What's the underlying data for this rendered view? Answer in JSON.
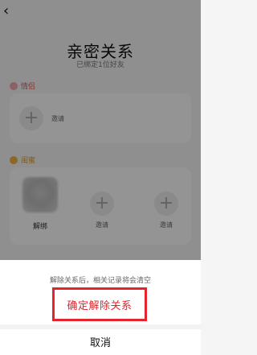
{
  "header": {
    "back_icon": "chevron-left-icon",
    "title": "亲密关系",
    "subtitle": "已绑定1位好友"
  },
  "sections": [
    {
      "label": "情侣",
      "icon": "heart-badge-icon",
      "color": "#e45b5b",
      "slots": [
        {
          "type": "add",
          "label": "邀请"
        }
      ]
    },
    {
      "label": "闺蜜",
      "icon": "bestie-badge-icon",
      "color": "#e39a2a",
      "slots": [
        {
          "type": "friend",
          "label": "解绑"
        },
        {
          "type": "add",
          "label": "邀请"
        },
        {
          "type": "add",
          "label": "邀请"
        }
      ]
    }
  ],
  "sheet": {
    "hint": "解除关系后，相关记录将会清空",
    "confirm_label": "确定解除关系",
    "cancel_label": "取消",
    "highlight_color": "#e4232a"
  }
}
